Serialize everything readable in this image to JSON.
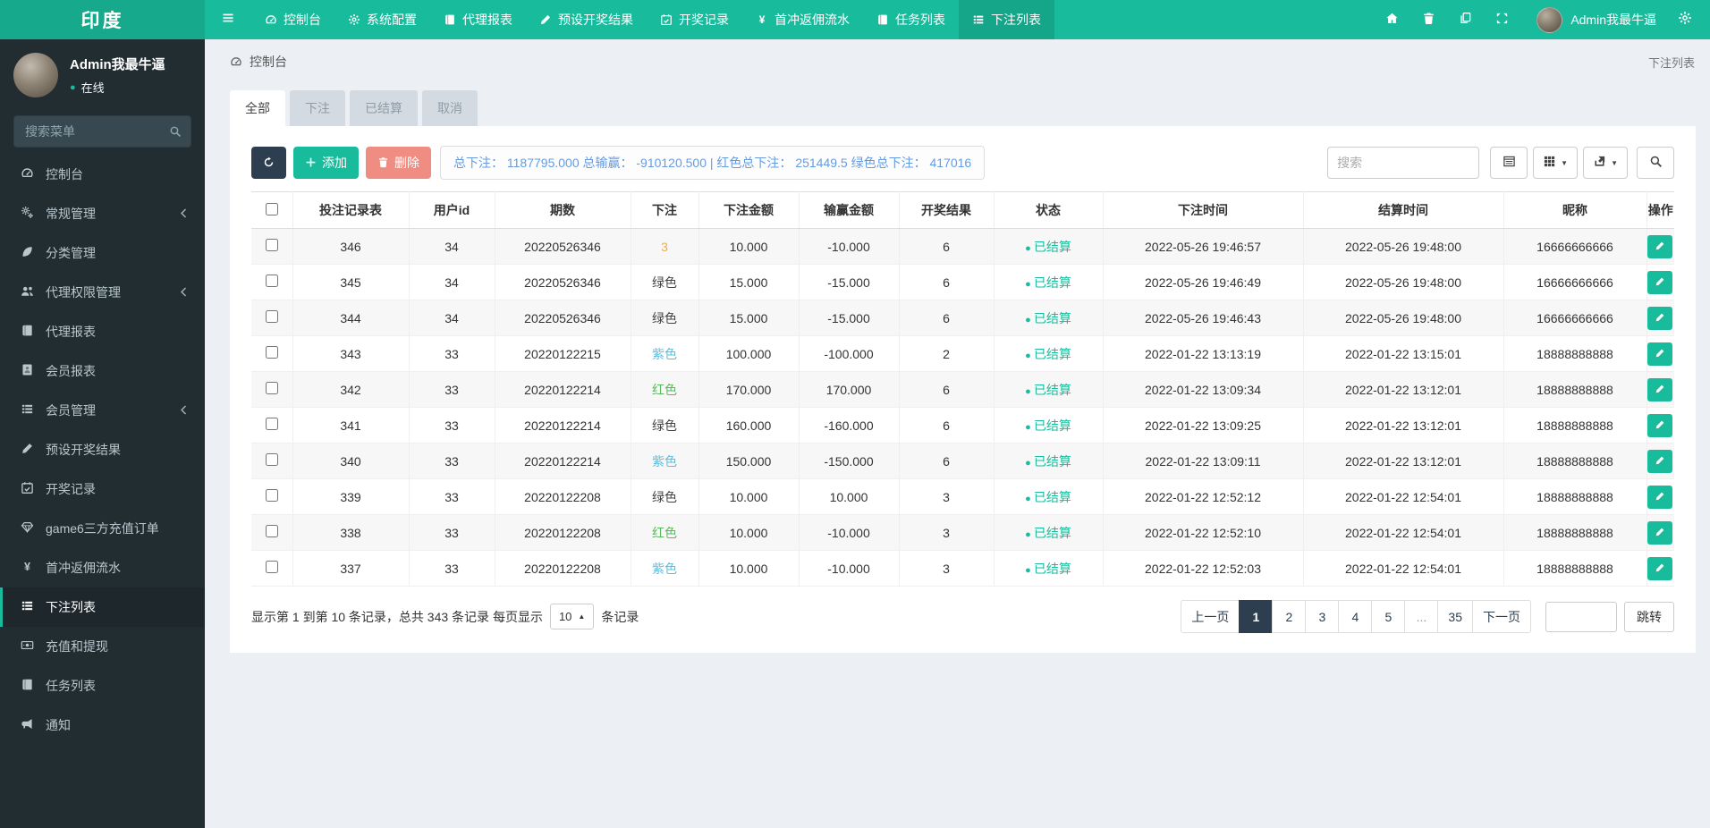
{
  "colors": {
    "accent_teal": "#18bc9c",
    "navbar_brand": "#16a98c",
    "sidebar_dark": "#222d32",
    "navy": "#2c3e50",
    "danger_red": "#e74c3c",
    "delete_soft_red": "#ef8d82",
    "summary_blue": "#659be0",
    "bet_orange": "#f0ad4e",
    "bet_green": "#5cb85c",
    "bet_lightblue": "#5bc0de",
    "page_bg": "#ecf0f5"
  },
  "navbar": {
    "brand": "印度",
    "items": [
      {
        "name": "dashboard",
        "label": "控制台",
        "icon": "dashboard-icon",
        "active": false
      },
      {
        "name": "system-config",
        "label": "系统配置",
        "icon": "gear-icon",
        "active": false
      },
      {
        "name": "agent-report",
        "label": "代理报表",
        "icon": "book-icon",
        "active": false
      },
      {
        "name": "preset-results",
        "label": "预设开奖结果",
        "icon": "pen-icon",
        "active": false
      },
      {
        "name": "draw-records",
        "label": "开奖记录",
        "icon": "calendar-icon",
        "active": false
      },
      {
        "name": "first-deposit-rebate",
        "label": "首冲返佣流水",
        "icon": "yen-icon",
        "active": false
      },
      {
        "name": "task-list",
        "label": "任务列表",
        "icon": "book-icon",
        "active": false
      },
      {
        "name": "bet-list",
        "label": "下注列表",
        "icon": "list-icon",
        "active": true
      }
    ],
    "right_icons": [
      {
        "name": "home",
        "icon": "home-icon"
      },
      {
        "name": "trash",
        "icon": "trash-icon"
      },
      {
        "name": "copy",
        "icon": "copy-icon"
      },
      {
        "name": "fullscreen",
        "icon": "expand-icon"
      }
    ],
    "user_name": "Admin我最牛逼"
  },
  "sidebar": {
    "user_name": "Admin我最牛逼",
    "user_status": "在线",
    "search_placeholder": "搜索菜单",
    "items": [
      {
        "name": "dashboard",
        "label": "控制台",
        "icon": "dashboard-icon",
        "expandable": false,
        "active": false
      },
      {
        "name": "general-management",
        "label": "常规管理",
        "icon": "gears-icon",
        "expandable": true,
        "active": false
      },
      {
        "name": "category-management",
        "label": "分类管理",
        "icon": "leaf-icon",
        "expandable": false,
        "active": false
      },
      {
        "name": "agent-permission",
        "label": "代理权限管理",
        "icon": "users-icon",
        "expandable": true,
        "active": false
      },
      {
        "name": "agent-report",
        "label": "代理报表",
        "icon": "book-icon",
        "expandable": false,
        "active": false
      },
      {
        "name": "member-report",
        "label": "会员报表",
        "icon": "address-book-icon",
        "expandable": false,
        "active": false
      },
      {
        "name": "member-management",
        "label": "会员管理",
        "icon": "list-icon",
        "expandable": true,
        "active": false
      },
      {
        "name": "preset-results",
        "label": "预设开奖结果",
        "icon": "pen-icon",
        "expandable": false,
        "active": false
      },
      {
        "name": "draw-records",
        "label": "开奖记录",
        "icon": "calendar-icon",
        "expandable": false,
        "active": false
      },
      {
        "name": "game6-recharge-orders",
        "label": "game6三方充值订单",
        "icon": "gem-icon",
        "expandable": false,
        "active": false
      },
      {
        "name": "first-deposit-rebate",
        "label": "首冲返佣流水",
        "icon": "yen-icon",
        "expandable": false,
        "active": false
      },
      {
        "name": "bet-list",
        "label": "下注列表",
        "icon": "list-icon",
        "expandable": false,
        "active": true
      },
      {
        "name": "recharge-withdraw",
        "label": "充值和提现",
        "icon": "money-icon",
        "expandable": false,
        "active": false
      },
      {
        "name": "task-list",
        "label": "任务列表",
        "icon": "book-icon",
        "expandable": false,
        "active": false
      },
      {
        "name": "notice",
        "label": "通知",
        "icon": "bullhorn-icon",
        "expandable": false,
        "active": false
      }
    ]
  },
  "breadcrumb": {
    "title": "控制台",
    "page": "下注列表"
  },
  "tabs": [
    {
      "name": "all",
      "label": "全部",
      "active": true
    },
    {
      "name": "bet",
      "label": "下注",
      "active": false
    },
    {
      "name": "settled",
      "label": "已结算",
      "active": false
    },
    {
      "name": "cancel",
      "label": "取消",
      "active": false
    }
  ],
  "toolbar": {
    "add_label": "添加",
    "delete_label": "删除",
    "summary": "总下注： 1187795.000 总输赢： -910120.500 | 红色总下注： 251449.5 绿色总下注： 417016",
    "search_placeholder": "搜索"
  },
  "table": {
    "columns": [
      "投注记录表",
      "用户id",
      "期数",
      "下注",
      "下注金额",
      "输赢金额",
      "开奖结果",
      "状态",
      "下注时间",
      "结算时间",
      "昵称",
      "操作"
    ],
    "rows": [
      {
        "record_id": "346",
        "user_id": "34",
        "issue": "20220526346",
        "bet": "3",
        "bet_color": "orange",
        "bet_amount": "10.000",
        "win_lose": "-10.000",
        "result": "6",
        "status": "已结算",
        "bet_time": "2022-05-26 19:46:57",
        "settle_time": "2022-05-26 19:48:00",
        "nickname": "16666666666"
      },
      {
        "record_id": "345",
        "user_id": "34",
        "issue": "20220526346",
        "bet": "绿色",
        "bet_color": "default",
        "bet_amount": "15.000",
        "win_lose": "-15.000",
        "result": "6",
        "status": "已结算",
        "bet_time": "2022-05-26 19:46:49",
        "settle_time": "2022-05-26 19:48:00",
        "nickname": "16666666666"
      },
      {
        "record_id": "344",
        "user_id": "34",
        "issue": "20220526346",
        "bet": "绿色",
        "bet_color": "default",
        "bet_amount": "15.000",
        "win_lose": "-15.000",
        "result": "6",
        "status": "已结算",
        "bet_time": "2022-05-26 19:46:43",
        "settle_time": "2022-05-26 19:48:00",
        "nickname": "16666666666"
      },
      {
        "record_id": "343",
        "user_id": "33",
        "issue": "20220122215",
        "bet": "紫色",
        "bet_color": "info",
        "bet_amount": "100.000",
        "win_lose": "-100.000",
        "result": "2",
        "status": "已结算",
        "bet_time": "2022-01-22 13:13:19",
        "settle_time": "2022-01-22 13:15:01",
        "nickname": "18888888888"
      },
      {
        "record_id": "342",
        "user_id": "33",
        "issue": "20220122214",
        "bet": "红色",
        "bet_color": "green",
        "bet_amount": "170.000",
        "win_lose": "170.000",
        "result": "6",
        "status": "已结算",
        "bet_time": "2022-01-22 13:09:34",
        "settle_time": "2022-01-22 13:12:01",
        "nickname": "18888888888"
      },
      {
        "record_id": "341",
        "user_id": "33",
        "issue": "20220122214",
        "bet": "绿色",
        "bet_color": "default",
        "bet_amount": "160.000",
        "win_lose": "-160.000",
        "result": "6",
        "status": "已结算",
        "bet_time": "2022-01-22 13:09:25",
        "settle_time": "2022-01-22 13:12:01",
        "nickname": "18888888888"
      },
      {
        "record_id": "340",
        "user_id": "33",
        "issue": "20220122214",
        "bet": "紫色",
        "bet_color": "info",
        "bet_amount": "150.000",
        "win_lose": "-150.000",
        "result": "6",
        "status": "已结算",
        "bet_time": "2022-01-22 13:09:11",
        "settle_time": "2022-01-22 13:12:01",
        "nickname": "18888888888"
      },
      {
        "record_id": "339",
        "user_id": "33",
        "issue": "20220122208",
        "bet": "绿色",
        "bet_color": "default",
        "bet_amount": "10.000",
        "win_lose": "10.000",
        "result": "3",
        "status": "已结算",
        "bet_time": "2022-01-22 12:52:12",
        "settle_time": "2022-01-22 12:54:01",
        "nickname": "18888888888"
      },
      {
        "record_id": "338",
        "user_id": "33",
        "issue": "20220122208",
        "bet": "红色",
        "bet_color": "green",
        "bet_amount": "10.000",
        "win_lose": "-10.000",
        "result": "3",
        "status": "已结算",
        "bet_time": "2022-01-22 12:52:10",
        "settle_time": "2022-01-22 12:54:01",
        "nickname": "18888888888"
      },
      {
        "record_id": "337",
        "user_id": "33",
        "issue": "20220122208",
        "bet": "紫色",
        "bet_color": "info",
        "bet_amount": "10.000",
        "win_lose": "-10.000",
        "result": "3",
        "status": "已结算",
        "bet_time": "2022-01-22 12:52:03",
        "settle_time": "2022-01-22 12:54:01",
        "nickname": "18888888888"
      }
    ]
  },
  "footer": {
    "info_prefix": "显示第 1 到第 10 条记录，总共 343 条记录 每页显示",
    "page_size": "10",
    "info_suffix": "条记录",
    "pages": [
      {
        "label": "上一页",
        "active": false
      },
      {
        "label": "1",
        "active": true
      },
      {
        "label": "2",
        "active": false
      },
      {
        "label": "3",
        "active": false
      },
      {
        "label": "4",
        "active": false
      },
      {
        "label": "5",
        "active": false
      },
      {
        "label": "...",
        "active": false
      },
      {
        "label": "35",
        "active": false
      },
      {
        "label": "下一页",
        "active": false
      }
    ],
    "jump_label": "跳转"
  }
}
